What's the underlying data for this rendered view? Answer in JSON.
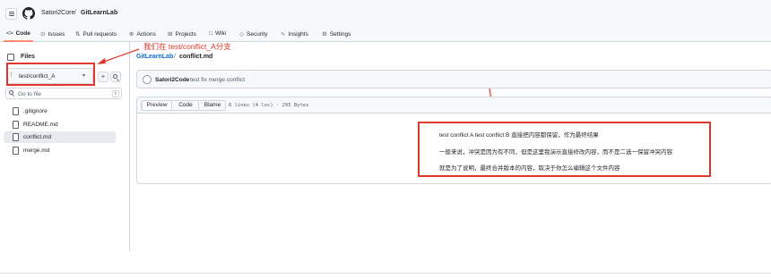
{
  "header": {
    "owner": "Satori2Core",
    "separator": "/",
    "repo": "GitLearnLab"
  },
  "nav_tabs": [
    {
      "label": "Code",
      "icon": "code-icon"
    },
    {
      "label": "Issues",
      "icon": "issue-icon"
    },
    {
      "label": "Pull requests",
      "icon": "pull-request-icon"
    },
    {
      "label": "Actions",
      "icon": "play-icon"
    },
    {
      "label": "Projects",
      "icon": "table-icon"
    },
    {
      "label": "Wiki",
      "icon": "book-icon"
    },
    {
      "label": "Security",
      "icon": "shield-icon"
    },
    {
      "label": "Insights",
      "icon": "graph-icon"
    },
    {
      "label": "Settings",
      "icon": "gear-icon"
    }
  ],
  "sidebar": {
    "title": "Files",
    "branch": "test/conflict_A",
    "add_label": "+",
    "search_placeholder": "Go to file",
    "search_shortcut": "t",
    "files": [
      {
        "name": ".gitignore",
        "selected": false
      },
      {
        "name": "README.md",
        "selected": false
      },
      {
        "name": "conflict.md",
        "selected": true
      },
      {
        "name": "merge.md",
        "selected": false
      }
    ]
  },
  "annotation": {
    "text": "我们在 test/conflict_A分支",
    "color": "#e0392b"
  },
  "breadcrumb": {
    "repo": "GitLearnLab",
    "separator": "/",
    "file": "conflict.md"
  },
  "commit": {
    "author": "Satori2Code",
    "message": "test fix merge conflict"
  },
  "file_view": {
    "tabs": [
      "Preview",
      "Code",
      "Blame"
    ],
    "active_tab": "Preview",
    "meta": "6 lines (4 loc) · 295 Bytes",
    "content_lines": [
      "test conflict A test conflict B 直接把内容都保留，作为最终结果",
      "一般来说，冲突是因为有不同，但是这里我演示直接修改内容，而不是二选一保留冲突内容",
      "就是为了说明，最终合并版本的内容，取决于你怎么编辑这个文件内容"
    ]
  },
  "colors": {
    "accent_link": "#0969da",
    "active_tab_underline": "#fd8c73",
    "annotation_red": "#e0392b"
  }
}
